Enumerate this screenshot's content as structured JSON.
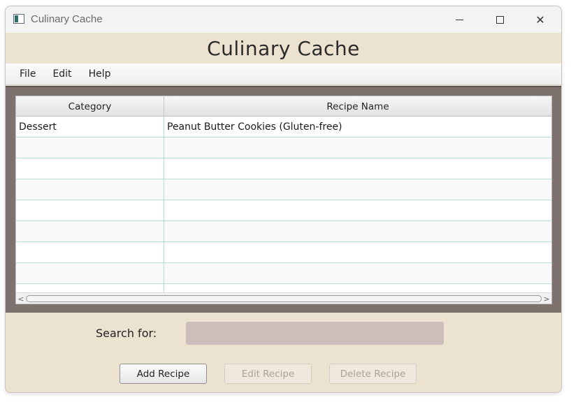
{
  "window": {
    "title": "Culinary Cache",
    "minimize_glyph": "",
    "maximize_glyph": "",
    "close_glyph": "✕"
  },
  "header": {
    "title": "Culinary Cache"
  },
  "menu": {
    "items": [
      "File",
      "Edit",
      "Help"
    ]
  },
  "table": {
    "columns": [
      "Category",
      "Recipe Name"
    ],
    "rows": [
      {
        "category": "Dessert",
        "name": "Peanut Butter Cookies (Gluten-free)"
      },
      {
        "category": "",
        "name": ""
      },
      {
        "category": "",
        "name": ""
      },
      {
        "category": "",
        "name": ""
      },
      {
        "category": "",
        "name": ""
      },
      {
        "category": "",
        "name": ""
      },
      {
        "category": "",
        "name": ""
      },
      {
        "category": "",
        "name": ""
      },
      {
        "category": "",
        "name": ""
      }
    ],
    "scroll_left_glyph": "<",
    "scroll_right_glyph": ">"
  },
  "search": {
    "label": "Search for:",
    "value": "",
    "placeholder": ""
  },
  "buttons": {
    "add": "Add Recipe",
    "edit": "Edit Recipe",
    "delete": "Delete Recipe"
  },
  "colors": {
    "background": "#ece2d0",
    "table_frame": "#7d726d",
    "search_field": "#cdbdbb",
    "grid_line": "#b8e0d2"
  }
}
